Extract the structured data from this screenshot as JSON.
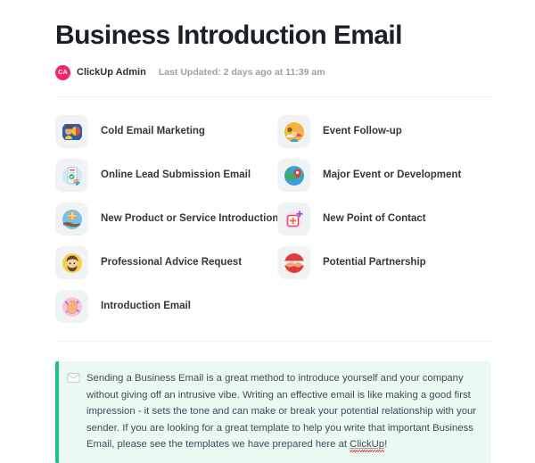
{
  "header": {
    "title": "Business Introduction Email",
    "avatar_initials": "CA",
    "avatar_color": "#f0256a",
    "author": "ClickUp Admin",
    "updated": "Last Updated: 2 days ago at 11:39 am"
  },
  "items": [
    {
      "label": "Cold Email Marketing",
      "icon": "person-with-pie-chart-icon",
      "color": "#f05a8c"
    },
    {
      "label": "Event Follow-up",
      "icon": "group-of-people-icon",
      "color": "#f5b731"
    },
    {
      "label": "Online Lead Submission Email",
      "icon": "mobile-form-hand-icon",
      "color": "#b9dff5"
    },
    {
      "label": "Major Event or Development",
      "icon": "globe-location-pin-icon",
      "color": "#3fae5a"
    },
    {
      "label": "New Product or Service Introduction",
      "icon": "hand-holding-box-icon",
      "color": "#6fc4ee"
    },
    {
      "label": "New Point of Contact",
      "icon": "add-contact-plus-icon",
      "color": "#f26f4d"
    },
    {
      "label": "Professional Advice Request",
      "icon": "bearded-person-icon",
      "color": "#f7d04a"
    },
    {
      "label": "Potential Partnership",
      "icon": "handshake-icon",
      "color": "#e23b3b"
    },
    {
      "label": "Introduction Email",
      "icon": "waving-hand-icon",
      "color": "#f7b8d8"
    }
  ],
  "callout": {
    "icon": "envelope-icon",
    "accent_color": "#1fc08a",
    "background_color": "#eafaf2",
    "text_part_1": "Sending a Business Email is a great method to introduce yourself and your company without giving off an intrusive vibe. Writing an effective email is like making a good first impression - it sets the tone and can make or break your potential relationship with your sender. If you are looking for a great template to help you write that important Business Email, please see the templates we have prepared here at ",
    "link_text": "ClickUp",
    "text_part_2": "!"
  }
}
